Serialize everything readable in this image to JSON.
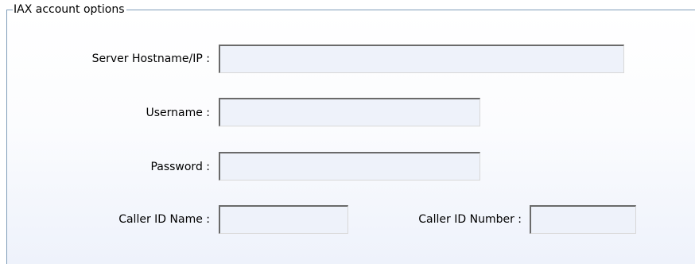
{
  "section": {
    "title": "IAX account options"
  },
  "fields": {
    "server_hostname": {
      "label": "Server Hostname/IP :",
      "value": ""
    },
    "username": {
      "label": "Username :",
      "value": ""
    },
    "password": {
      "label": "Password :",
      "value": ""
    },
    "caller_id_name": {
      "label": "Caller ID Name :",
      "value": ""
    },
    "caller_id_number": {
      "label": "Caller ID Number :",
      "value": ""
    }
  }
}
